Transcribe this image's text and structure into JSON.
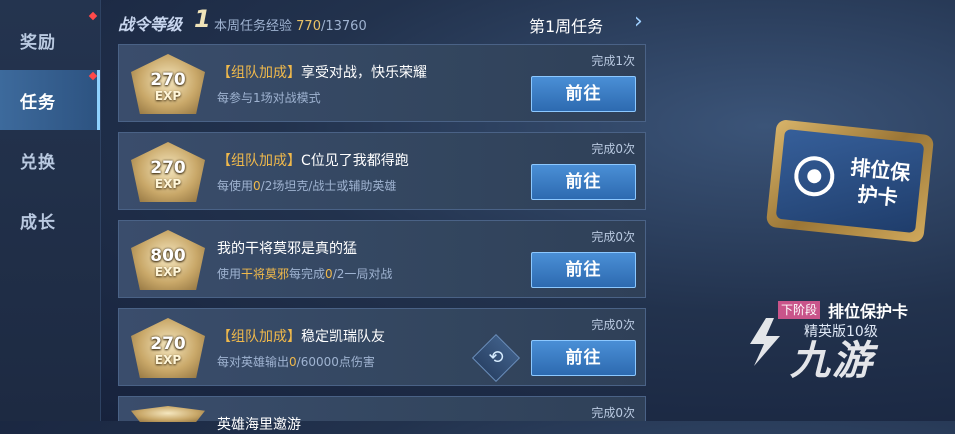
{
  "sidebar": {
    "items": [
      {
        "label": "奖励"
      },
      {
        "label": "任务"
      },
      {
        "label": "兑换"
      },
      {
        "label": "成长"
      }
    ]
  },
  "header": {
    "level_label": "战令等级",
    "level_value": "1",
    "exp_prefix": "本周任务经验",
    "exp_current": "770",
    "exp_total": "/13760",
    "week_label": "第1周任务"
  },
  "tasks": [
    {
      "exp": "270",
      "exp_unit": "EXP",
      "tag": "【组队加成】",
      "title": "享受对战，快乐荣耀",
      "desc": "每参与1场对战模式",
      "completed": "完成1次",
      "button": "前往"
    },
    {
      "exp": "270",
      "exp_unit": "EXP",
      "tag": "【组队加成】",
      "title": "C位见了我都得跑",
      "desc_pre": "每使用",
      "desc_cur": "0",
      "desc_post": "/2场坦克/战士或辅助英雄",
      "completed": "完成0次",
      "button": "前往"
    },
    {
      "exp": "800",
      "exp_unit": "EXP",
      "title": "我的干将莫邪是真的猛",
      "desc_pre": "使用",
      "desc_hero": "干将莫邪",
      "desc_mid": "每完成",
      "desc_cur": "0",
      "desc_post": "/2一局对战",
      "completed": "完成0次",
      "button": "前往"
    },
    {
      "exp": "270",
      "exp_unit": "EXP",
      "tag": "【组队加成】",
      "title": "稳定凯瑞队友",
      "desc_pre": "每对英雄输出",
      "desc_cur": "0",
      "desc_post": "/60000点伤害",
      "completed": "完成0次",
      "button": "前往"
    },
    {
      "title": "英雄海里邀游",
      "completed": "完成0次"
    }
  ],
  "reward": {
    "card_text": "排位保护卡",
    "tier_badge": "下阶段",
    "name": "排位保护卡",
    "sub": "精英版10级"
  },
  "watermark": "九游"
}
